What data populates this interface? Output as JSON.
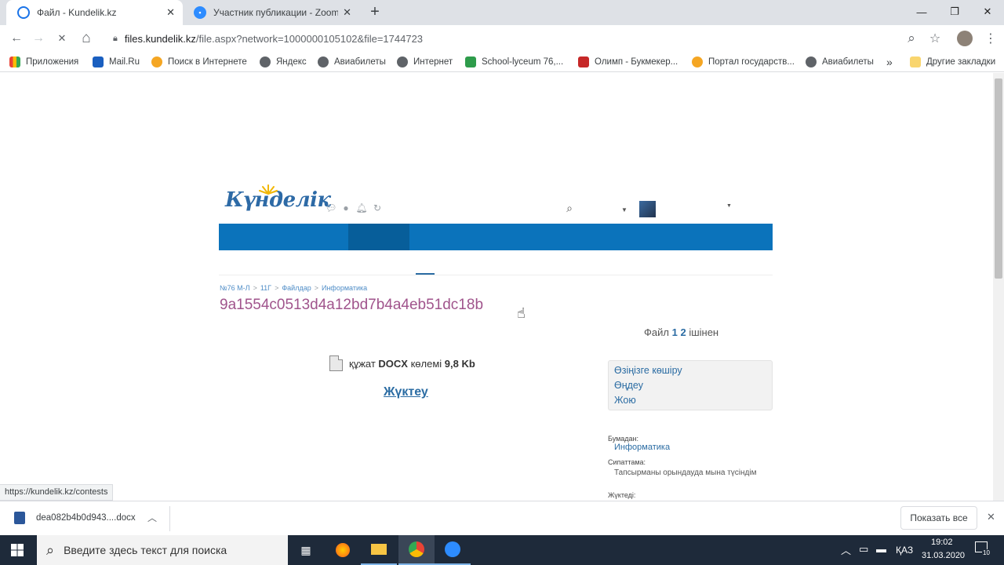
{
  "tabs": [
    {
      "title": "Файл - Kundelik.kz",
      "active": true
    },
    {
      "title": "Участник публикации - Zoom",
      "active": false
    }
  ],
  "new_tab_label": "+",
  "window": {
    "minimize": "—",
    "maximize": "❐",
    "close": "✕"
  },
  "toolbar": {
    "back": "←",
    "forward": "→",
    "stop": "✕",
    "home": "⌂",
    "search": "⌕",
    "star": "☆",
    "menu": "⋮"
  },
  "omnibox": {
    "host": "files.kundelik.kz",
    "path": "/file.aspx?network=1000000105102&file=1744723"
  },
  "bookmarks": [
    {
      "label": "Приложения",
      "color": "#e8453c"
    },
    {
      "label": "Mail.Ru",
      "color": "#1a5fc0"
    },
    {
      "label": "Поиск в Интернете",
      "color": "#f5a623"
    },
    {
      "label": "Яндекс",
      "color": "#5f6368"
    },
    {
      "label": "Авиабилеты",
      "color": "#5f6368"
    },
    {
      "label": "Интернет",
      "color": "#5f6368"
    },
    {
      "label": "School-lyceum 76,...",
      "color": "#2e9c4b"
    },
    {
      "label": "Олимп - Букмекер...",
      "color": "#c62828"
    },
    {
      "label": "Портал государств...",
      "color": "#f5a623"
    },
    {
      "label": "Авиабилеты",
      "color": "#5f6368"
    }
  ],
  "bookmarks_more": "»",
  "other_bookmarks": "Другие закладки",
  "site": {
    "logo": "Күнделік",
    "breadcrumbs": [
      "№76 М-Л",
      "11Г",
      "Файлдар",
      "Информатика"
    ],
    "file_hash": "9a1554c0513d4a12bd7b4a4eb51dc18b",
    "file_of": {
      "prefix": "Файл",
      "current": "1",
      "total": "2",
      "suffix": "ішінен"
    },
    "doc": {
      "prefix": "құжат",
      "type": "DOCX",
      "mid": "көлемі",
      "size": "9,8 Kb"
    },
    "download": "Жүктеу",
    "actions": [
      "Өзіңізге көшіру",
      "Өңдеу",
      "Жою"
    ],
    "folder_label": "Бумадан:",
    "folder_value": "Информатика",
    "desc_label": "Сипаттама:",
    "desc_value": "Тапсырманы орындауда мына түсіндім",
    "uploaded_label": "Жүктеді:"
  },
  "status_url": "https://kundelik.kz/contests",
  "download_shelf": {
    "file": "dea082b4b0d943....docx",
    "show_all": "Показать все",
    "close": "✕"
  },
  "taskbar": {
    "search_placeholder": "Введите здесь текст для поиска",
    "lang": "ҚАЗ",
    "time": "19:02",
    "date": "31.03.2020",
    "notif_count": "10"
  }
}
